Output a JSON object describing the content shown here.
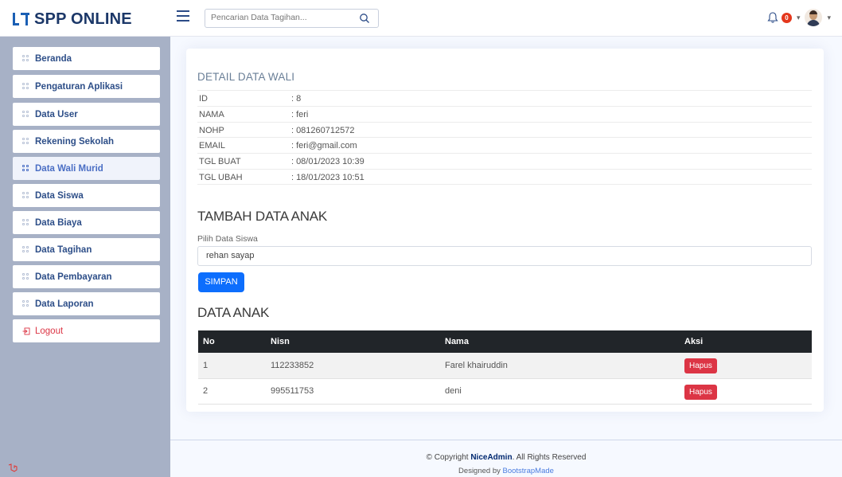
{
  "app": {
    "logo": "SPP ONLINE"
  },
  "header": {
    "search_placeholder": "Pencarian Data Tagihan...",
    "notification_count": "0"
  },
  "sidebar": {
    "items": [
      {
        "label": "Beranda"
      },
      {
        "label": "Pengaturan Aplikasi"
      },
      {
        "label": "Data User"
      },
      {
        "label": "Rekening Sekolah"
      },
      {
        "label": "Data Wali Murid"
      },
      {
        "label": "Data Siswa"
      },
      {
        "label": "Data Biaya"
      },
      {
        "label": "Data Tagihan"
      },
      {
        "label": "Data Pembayaran"
      },
      {
        "label": "Data Laporan"
      },
      {
        "label": "Logout"
      }
    ]
  },
  "detail": {
    "title": "DETAIL DATA WALI",
    "rows": [
      {
        "key": "ID",
        "value": "8"
      },
      {
        "key": "NAMA",
        "value": "feri"
      },
      {
        "key": "NOHP",
        "value": "081260712572"
      },
      {
        "key": "EMAIL",
        "value": "feri@gmail.com"
      },
      {
        "key": "TGL BUAT",
        "value": "08/01/2023 10:39"
      },
      {
        "key": "TGL UBAH",
        "value": "18/01/2023 10:51"
      }
    ]
  },
  "add_child": {
    "title": "TAMBAH DATA ANAK",
    "field_label": "Pilih Data Siswa",
    "selected": "rehan sayap",
    "save_label": "SIMPAN"
  },
  "children": {
    "title": "DATA ANAK",
    "columns": [
      "No",
      "Nisn",
      "Nama",
      "Aksi"
    ],
    "rows": [
      {
        "no": "1",
        "nisn": "112233852",
        "nama": "Farel khairuddin",
        "action": "Hapus"
      },
      {
        "no": "2",
        "nisn": "995511753",
        "nama": "deni",
        "action": "Hapus"
      }
    ]
  },
  "footer": {
    "copyright_prefix": "© Copyright ",
    "brand": "NiceAdmin",
    "copyright_suffix": ". All Rights Reserved",
    "designed_prefix": "Designed by ",
    "designer": "BootstrapMade"
  }
}
